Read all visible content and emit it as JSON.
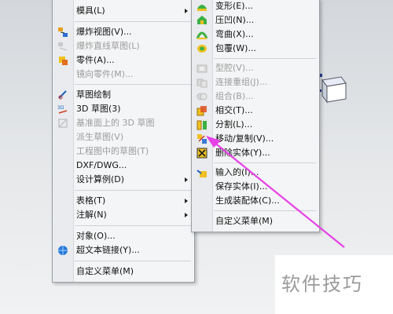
{
  "left_menu": {
    "items": [
      {
        "label": "模具(L)",
        "disabled": false,
        "submenu": true,
        "icon": "none"
      },
      {
        "label": "爆炸视图(V)...",
        "disabled": false,
        "submenu": false,
        "icon": "explode-view-icon"
      },
      {
        "label": "爆炸直线草图(L)",
        "disabled": true,
        "submenu": false,
        "icon": "explode-line-icon"
      },
      {
        "label": "零件(A)...",
        "disabled": false,
        "submenu": false,
        "icon": "part-icon"
      },
      {
        "label": "镜向零件(M)...",
        "disabled": true,
        "submenu": false,
        "icon": "none"
      },
      {
        "label": "草图绘制",
        "disabled": false,
        "submenu": false,
        "icon": "sketch-icon"
      },
      {
        "label": "3D 草图(3)",
        "disabled": false,
        "submenu": false,
        "icon": "3d-sketch-icon"
      },
      {
        "label": "基准面上的 3D 草图",
        "disabled": true,
        "submenu": false,
        "icon": "3d-sketch-plane-icon"
      },
      {
        "label": "派生草图(V)",
        "disabled": true,
        "submenu": false,
        "icon": "none"
      },
      {
        "label": "工程图中的草图(T)",
        "disabled": true,
        "submenu": false,
        "icon": "none"
      },
      {
        "label": "DXF/DWG...",
        "disabled": false,
        "submenu": false,
        "icon": "none"
      },
      {
        "label": "设计算例(D)",
        "disabled": false,
        "submenu": true,
        "icon": "none"
      },
      {
        "label": "表格(T)",
        "disabled": false,
        "submenu": true,
        "icon": "none"
      },
      {
        "label": "注解(N)",
        "disabled": false,
        "submenu": true,
        "icon": "none"
      },
      {
        "label": "对象(O)...",
        "disabled": false,
        "submenu": false,
        "icon": "none"
      },
      {
        "label": "超文本链接(Y)...",
        "disabled": false,
        "submenu": false,
        "icon": "hyperlink-globe-icon"
      },
      {
        "label": "自定义菜单(M)",
        "disabled": false,
        "submenu": false,
        "icon": "none"
      }
    ]
  },
  "right_menu": {
    "items": [
      {
        "label": "变形(E)...",
        "disabled": false,
        "icon": "deform-icon"
      },
      {
        "label": "压凹(N)...",
        "disabled": false,
        "icon": "indent-icon"
      },
      {
        "label": "弯曲(X)...",
        "disabled": false,
        "icon": "flex-icon"
      },
      {
        "label": "包覆(W)...",
        "disabled": false,
        "icon": "wrap-icon"
      },
      {
        "label": "型腔(V)...",
        "disabled": true,
        "icon": "cavity-icon"
      },
      {
        "label": "连接重组(J)...",
        "disabled": true,
        "icon": "join-icon"
      },
      {
        "label": "组合(B)...",
        "disabled": true,
        "icon": "combine-icon"
      },
      {
        "label": "相交(T)...",
        "disabled": false,
        "icon": "intersect-icon"
      },
      {
        "label": "分割(L)...",
        "disabled": false,
        "icon": "split-icon"
      },
      {
        "label": "移动/复制(V)...",
        "disabled": false,
        "icon": "move-copy-icon"
      },
      {
        "label": "删除实体(Y)...",
        "disabled": false,
        "icon": "delete-body-icon"
      },
      {
        "label": "输入的(I)...",
        "disabled": false,
        "icon": "imported-icon"
      },
      {
        "label": "保存实体(I)...",
        "disabled": false,
        "icon": "none"
      },
      {
        "label": "生成装配体(C)...",
        "disabled": false,
        "icon": "none"
      },
      {
        "label": "自定义菜单(M)",
        "disabled": false,
        "icon": "none"
      }
    ]
  },
  "watermark": {
    "text": "软件技巧"
  },
  "colors": {
    "arrow": "#e640e6",
    "menu_bg": "#f4f5f6",
    "disabled_text": "#9c9c9c"
  }
}
